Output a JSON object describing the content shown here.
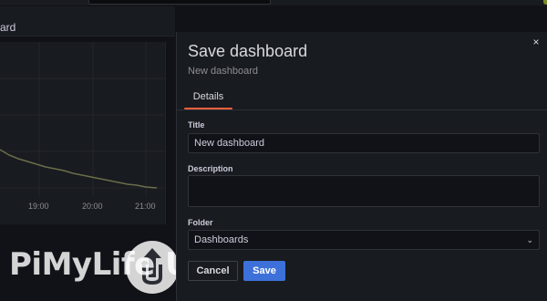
{
  "header": {
    "breadcrumb_fragment": "ard"
  },
  "panel": {
    "time_ticks": [
      "19:00",
      "20:00",
      "21:00"
    ]
  },
  "watermark": {
    "text": "PiMyLife Up"
  },
  "modal": {
    "title": "Save dashboard",
    "subtitle": "New dashboard",
    "close_label": "×",
    "tabs": [
      {
        "label": "Details",
        "active": true
      }
    ],
    "fields": {
      "title": {
        "label": "Title",
        "value": "New dashboard"
      },
      "description": {
        "label": "Description",
        "value": ""
      },
      "folder": {
        "label": "Folder",
        "value": "Dashboards"
      }
    },
    "buttons": {
      "cancel": "Cancel",
      "save": "Save"
    }
  },
  "colors": {
    "accent_tab": "#f55f3e",
    "primary_button": "#3d71d9",
    "background": "#111217",
    "surface": "#181b1f"
  }
}
